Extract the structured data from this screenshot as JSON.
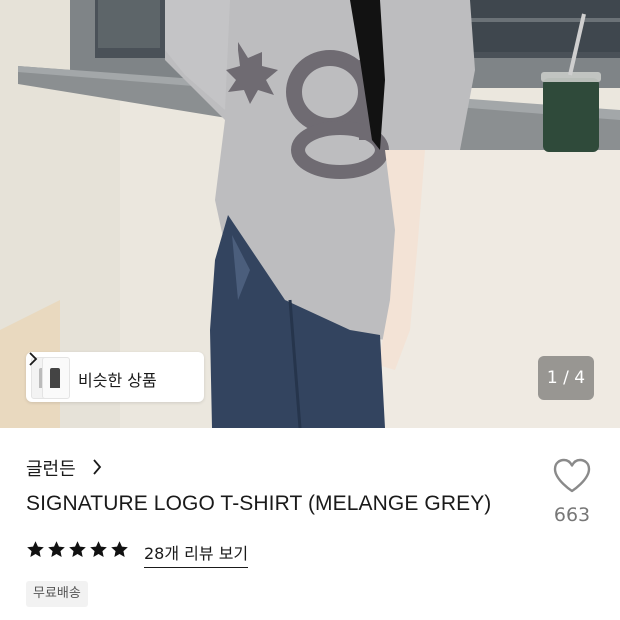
{
  "photo": {
    "similar_button_label": "비슷한 상품",
    "pager_text": "1 / 4",
    "shirt_print": "*g"
  },
  "product": {
    "brand": "글런든",
    "title": "SIGNATURE LOGO T-SHIRT (MELANGE GREY)",
    "rating_stars": 5,
    "review_link": "28개 리뷰 보기",
    "badge": "무료배송",
    "like_count": "663"
  },
  "colors": {
    "shirt": "#b9b9bb",
    "print": "#6f6b72",
    "jeans": "#33445f",
    "wall": "#ece8df"
  },
  "icons": {
    "brand_arrow": "chevron-right-icon",
    "similar_arrow": "chevron-right-icon",
    "star": "star-icon",
    "like": "heart-icon"
  }
}
